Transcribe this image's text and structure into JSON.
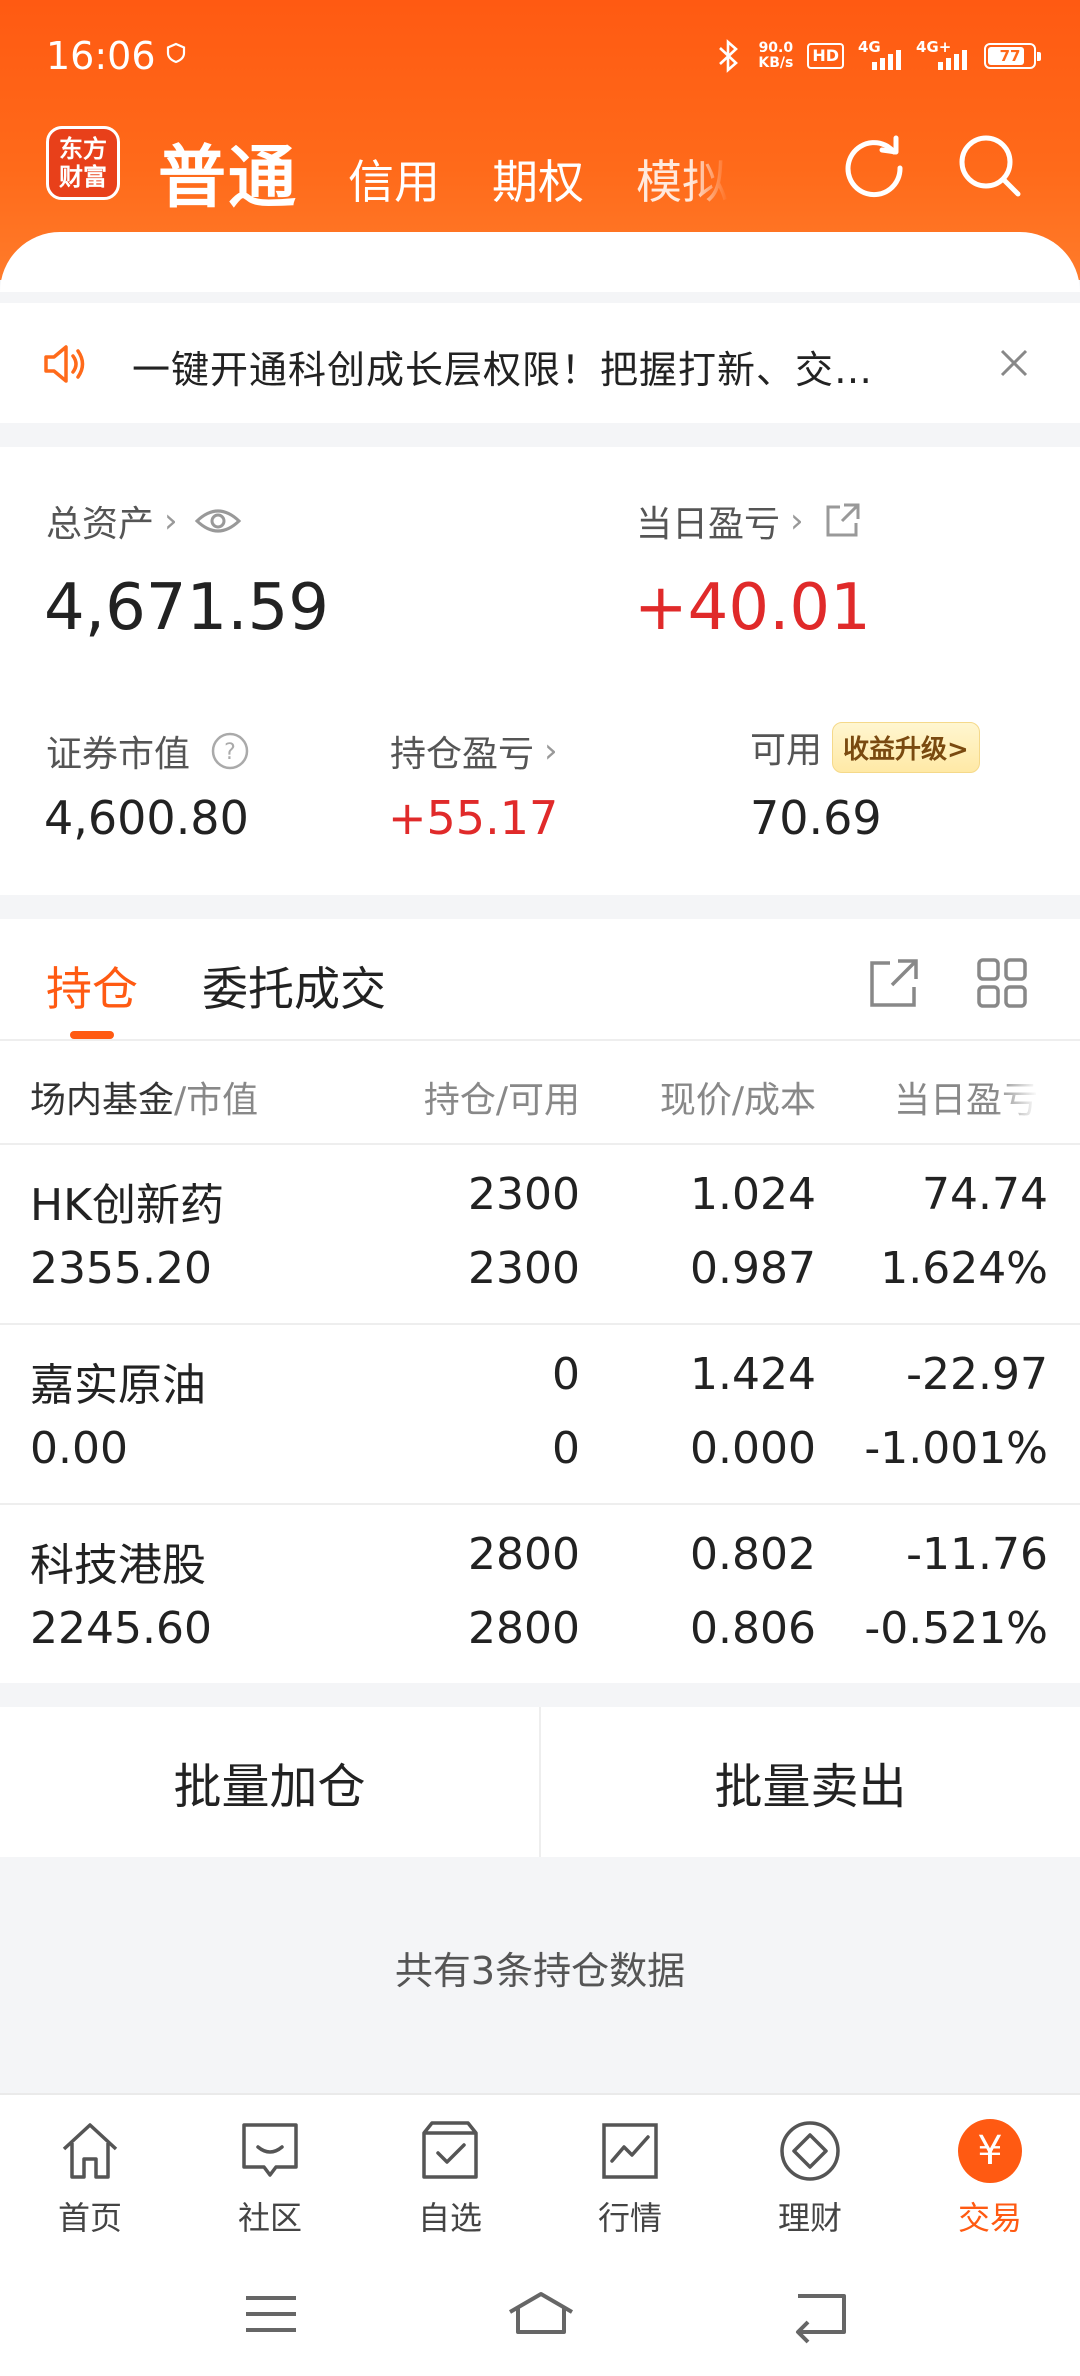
{
  "status_bar": {
    "time": "16:06",
    "net_speed_value": "90.0",
    "net_speed_unit": "KB/s",
    "hd": "HD",
    "sig1": "4G",
    "sig2": "4G+",
    "battery": "77"
  },
  "header": {
    "logo_line1": "东方",
    "logo_line2": "财富",
    "tabs": [
      {
        "label": "普通",
        "active": true
      },
      {
        "label": "信用"
      },
      {
        "label": "期权"
      },
      {
        "label": "模拟"
      }
    ]
  },
  "notice": {
    "text": "一键开通科创成长层权限！把握打新、交…"
  },
  "assets": {
    "total_label": "总资产",
    "total_value": "4,671.59",
    "daily_label": "当日盈亏",
    "daily_value": "+40.01",
    "market_label": "证券市值",
    "market_value": "4,600.80",
    "holding_label": "持仓盈亏",
    "holding_value": "+55.17",
    "available_label": "可用",
    "available_value": "70.69",
    "upgrade_tag": "收益升级>"
  },
  "position_tabs": {
    "holdings": "持仓",
    "orders": "委托成交"
  },
  "table": {
    "header": {
      "col1_main": "场内基金",
      "col1_sub": "/市值",
      "col2": "持仓/可用",
      "col3": "现价/成本",
      "col4": "当日盈亏"
    },
    "rows": [
      {
        "name": "HK创新药",
        "market_value": "2355.20",
        "hold": "2300",
        "avail": "2300",
        "price": "1.024",
        "cost": "0.987",
        "pnl": "74.74",
        "pnl_pct": "1.624%",
        "trend": "up"
      },
      {
        "name": "嘉实原油",
        "market_value": "0.00",
        "hold": "0",
        "avail": "0",
        "price": "1.424",
        "cost": "0.000",
        "pnl": "-22.97",
        "pnl_pct": "-1.001%",
        "trend": "down"
      },
      {
        "name": "科技港股",
        "market_value": "2245.60",
        "hold": "2800",
        "avail": "2800",
        "price": "0.802",
        "cost": "0.806",
        "pnl": "-11.76",
        "pnl_pct": "-0.521%",
        "trend": "down"
      }
    ]
  },
  "batch": {
    "add": "批量加仓",
    "sell": "批量卖出"
  },
  "summary": "共有3条持仓数据",
  "bottom_nav": [
    {
      "label": "首页",
      "icon": "home-icon"
    },
    {
      "label": "社区",
      "icon": "community-icon"
    },
    {
      "label": "自选",
      "icon": "watchlist-icon"
    },
    {
      "label": "行情",
      "icon": "market-icon"
    },
    {
      "label": "理财",
      "icon": "wealth-icon"
    },
    {
      "label": "交易",
      "icon": "trade-icon",
      "active": true,
      "glyph": "¥"
    }
  ],
  "colors": {
    "accent": "#ff5a12",
    "up": "#e02a2a",
    "down": "#1fa02a"
  }
}
